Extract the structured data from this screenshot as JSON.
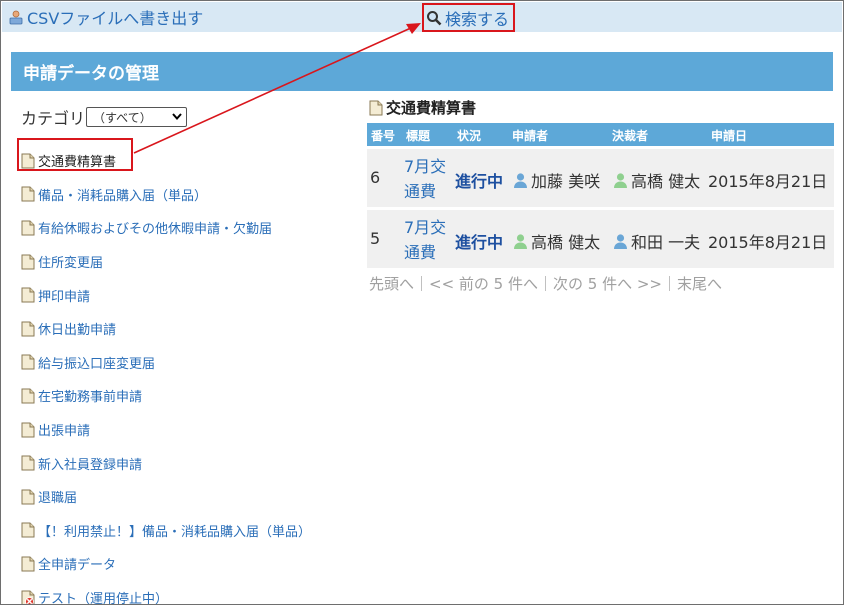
{
  "toolbar": {
    "csv_label": "CSVファイルへ書き出す",
    "search_label": "検索する"
  },
  "section": {
    "title": "申請データの管理"
  },
  "category": {
    "label": "カテゴリ",
    "selected": "（すべて）"
  },
  "forms": [
    {
      "label": "交通費精算書",
      "icon": "document-icon"
    },
    {
      "label": "備品・消耗品購入届（単品）",
      "icon": "document-icon"
    },
    {
      "label": "有給休暇およびその他休暇申請・欠勤届",
      "icon": "document-icon"
    },
    {
      "label": "住所変更届",
      "icon": "document-icon"
    },
    {
      "label": "押印申請",
      "icon": "document-icon"
    },
    {
      "label": "休日出勤申請",
      "icon": "document-icon"
    },
    {
      "label": "給与振込口座変更届",
      "icon": "document-icon"
    },
    {
      "label": "在宅勤務事前申請",
      "icon": "document-icon"
    },
    {
      "label": "出張申請",
      "icon": "document-icon"
    },
    {
      "label": "新入社員登録申請",
      "icon": "document-icon"
    },
    {
      "label": "退職届",
      "icon": "document-icon"
    },
    {
      "label": "【！利用禁止！】備品・消耗品購入届（単品）",
      "icon": "document-icon"
    },
    {
      "label": "全申請データ",
      "icon": "document-icon"
    },
    {
      "label": "テスト（運用停止中）",
      "icon": "document-stopped-icon"
    }
  ],
  "detail": {
    "title": "交通費精算書",
    "columns": [
      "番号",
      "標題",
      "状況",
      "申請者",
      "決裁者",
      "申請日"
    ],
    "rows": [
      {
        "number": "6",
        "title": "7月交通費",
        "status": "進行中",
        "applicant": "加藤 美咲",
        "approver": "高橋 健太",
        "date": "2015年8月21日"
      },
      {
        "number": "5",
        "title": "7月交通費",
        "status": "進行中",
        "applicant": "高橋 健太",
        "approver": "和田 一夫",
        "date": "2015年8月21日"
      }
    ],
    "pager": "先頭へ｜<< 前の 5 件へ｜次の 5 件へ >>｜末尾へ"
  },
  "colors": {
    "header_bg": "#5da8d8",
    "toolbar_bg": "#d8e8f4",
    "link": "#2a6eb8",
    "highlight": "#d9161c",
    "status": "#1e50a0"
  }
}
